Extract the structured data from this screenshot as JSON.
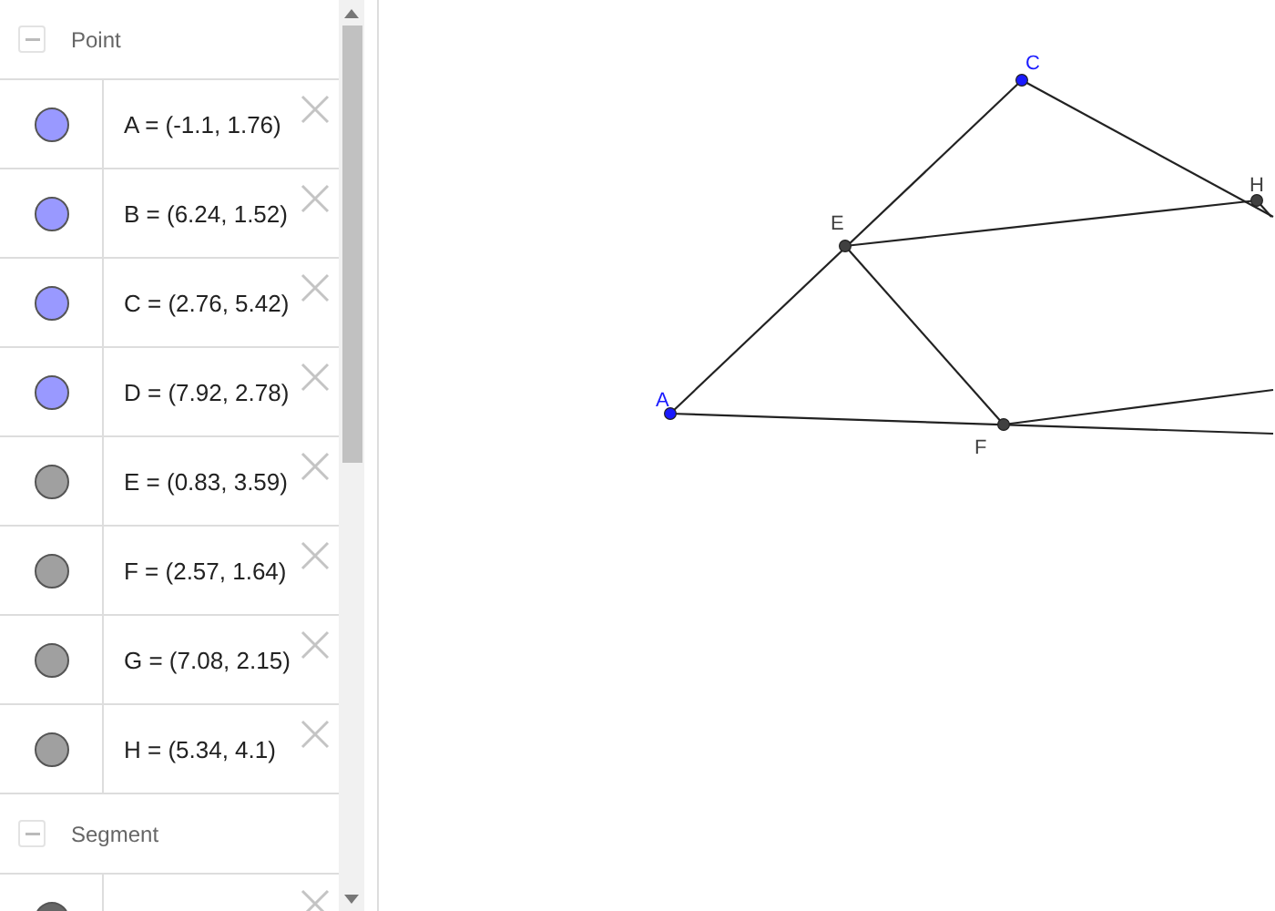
{
  "algebra": {
    "groups": [
      {
        "label": "Point",
        "expanded": true,
        "items": [
          {
            "text": "A = (-1.1, 1.76)",
            "color": "#9999ff"
          },
          {
            "text": "B = (6.24, 1.52)",
            "color": "#9999ff"
          },
          {
            "text": "C = (2.76, 5.42)",
            "color": "#9999ff"
          },
          {
            "text": "D = (7.92, 2.78)",
            "color": "#9999ff"
          },
          {
            "text": "E = (0.83, 3.59)",
            "color": "#a0a0a0"
          },
          {
            "text": "F = (2.57, 1.64)",
            "color": "#a0a0a0"
          },
          {
            "text": "G = (7.08, 2.15)",
            "color": "#a0a0a0"
          },
          {
            "text": "H = (5.34, 4.1)",
            "color": "#a0a0a0"
          }
        ]
      },
      {
        "label": "Segment",
        "expanded": true,
        "items": [
          {
            "color": "#666666"
          }
        ]
      }
    ]
  },
  "canvas": {
    "points": [
      {
        "label": "A",
        "color": "#1a1aff"
      },
      {
        "label": "C",
        "color": "#1a1aff"
      },
      {
        "label": "E",
        "color": "#404040"
      },
      {
        "label": "F",
        "color": "#404040"
      },
      {
        "label": "H",
        "color": "#404040"
      }
    ]
  }
}
